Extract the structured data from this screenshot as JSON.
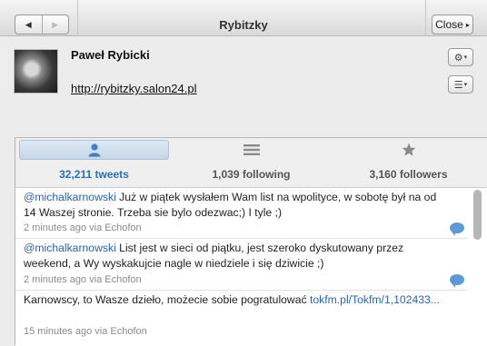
{
  "window": {
    "title": "Rybitzky"
  },
  "toolbar": {
    "back_symbol": "◀",
    "forward_symbol": "▶",
    "close_label": "Close",
    "close_arrow": "▸"
  },
  "profile": {
    "name": "Paweł Rybicki",
    "url": "http://rybitzky.salon24.pl",
    "gear_symbol": "⚙",
    "menu_symbol": "☰",
    "dropdown_symbol": "▾"
  },
  "tabs": [
    {
      "label": "32,211 tweets",
      "icon": "person-icon",
      "active": true
    },
    {
      "label": "1,039 following",
      "icon": "list-icon",
      "active": false
    },
    {
      "label": "3,160 followers",
      "icon": "star-icon",
      "active": false
    }
  ],
  "tweets": [
    {
      "mention": "@michalkarnowski",
      "text": " Już w piątek wysłałem Wam list na wpolityce, w sobotę był na od 14 Waszej stronie. Trzeba sie bylo odezwac;) I tyle ;)",
      "link": "",
      "meta": "2 minutes ago via Echofon"
    },
    {
      "mention": "@michalkarnowski",
      "text": " List jest w sieci od piątku, jest szeroko dyskutowany przez weekend, a Wy wyskakujcie nagle w niedziele i się dziwicie ;)",
      "link": "",
      "meta": "2 minutes ago via Echofon"
    },
    {
      "mention": "",
      "text": "Karnowscy, to Wasze dzieło, możecie sobie pogratulować ",
      "link": "tokfm.pl/Tokfm/1,102433...",
      "meta": "15 minutes ago via Echofon"
    }
  ],
  "colors": {
    "accent": "#2f6fb3",
    "link": "#2a62b5",
    "reply_bubble": "#5b9ad6"
  }
}
